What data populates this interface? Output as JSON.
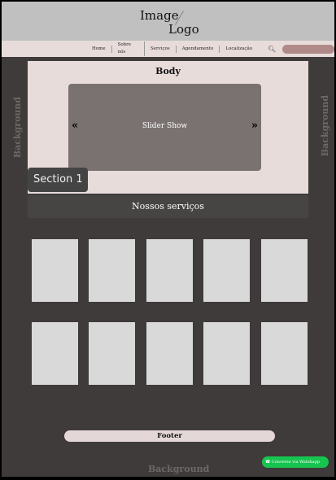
{
  "header": {
    "logo_line1": "Image",
    "logo_line2": "Logo"
  },
  "nav": {
    "items": [
      "Home",
      "Sobre nós",
      "Serviços",
      "Agendamento",
      "Localização"
    ],
    "search_icon": "search-icon"
  },
  "background_label": "Background",
  "body": {
    "title": "Body",
    "slider_label": "Slider Show",
    "prev": "«",
    "next": "»",
    "section_badge": "Section 1"
  },
  "services": {
    "title": "Nossos  serviços",
    "card_count": 10
  },
  "footer": {
    "label": "Footer"
  },
  "whatsapp": {
    "label": "Converse via Watshapp",
    "color": "#17c44f"
  }
}
